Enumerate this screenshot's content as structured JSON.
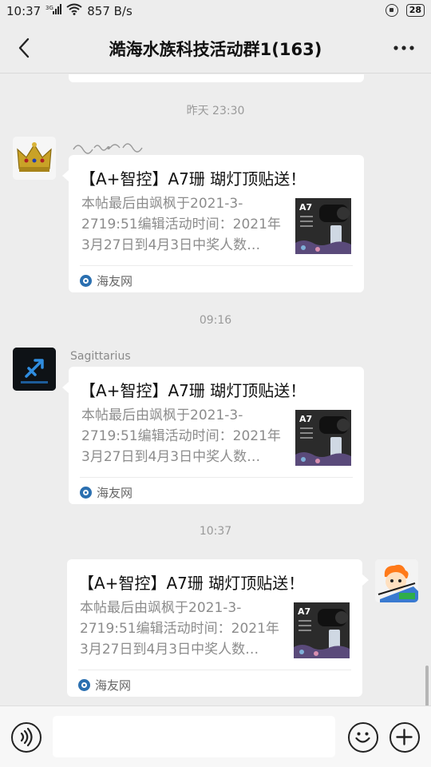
{
  "status_bar": {
    "time": "10:37",
    "network": "3G",
    "speed": "857 B/s",
    "battery": "28"
  },
  "header": {
    "title": "澔海水族科技活动群1(163)"
  },
  "messages": [
    {
      "time": "昨天 23:30",
      "sender": "",
      "card": {
        "title": "【A+智控】A7珊 瑚灯顶贴送！",
        "description": "本帖最后由飒枫于2021-3-2719:51编辑活动时间：2021年3月27日到4月3日中奖人数…",
        "source": "海友网",
        "thumb_label": "A7"
      }
    },
    {
      "time": "09:16",
      "sender": "Sagittarius",
      "card": {
        "title": "【A+智控】A7珊 瑚灯顶贴送！",
        "description": "本帖最后由飒枫于2021-3-2719:51编辑活动时间：2021年3月27日到4月3日中奖人数…",
        "source": "海友网",
        "thumb_label": "A7"
      }
    },
    {
      "time": "10:37",
      "sender": "",
      "card": {
        "title": "【A+智控】A7珊 瑚灯顶贴送！",
        "description": "本帖最后由飒枫于2021-3-2719:51编辑活动时间：2021年3月27日到4月3日中奖人数…",
        "source": "海友网",
        "thumb_label": "A7"
      }
    }
  ],
  "colors": {
    "background": "#ededed",
    "card": "#ffffff",
    "source_icon": "#2a6fb0"
  },
  "icons": [
    "back-icon",
    "more-icon",
    "voice-icon",
    "emoji-icon",
    "plus-icon",
    "signal-icon",
    "wifi-icon",
    "alarm-icon"
  ]
}
